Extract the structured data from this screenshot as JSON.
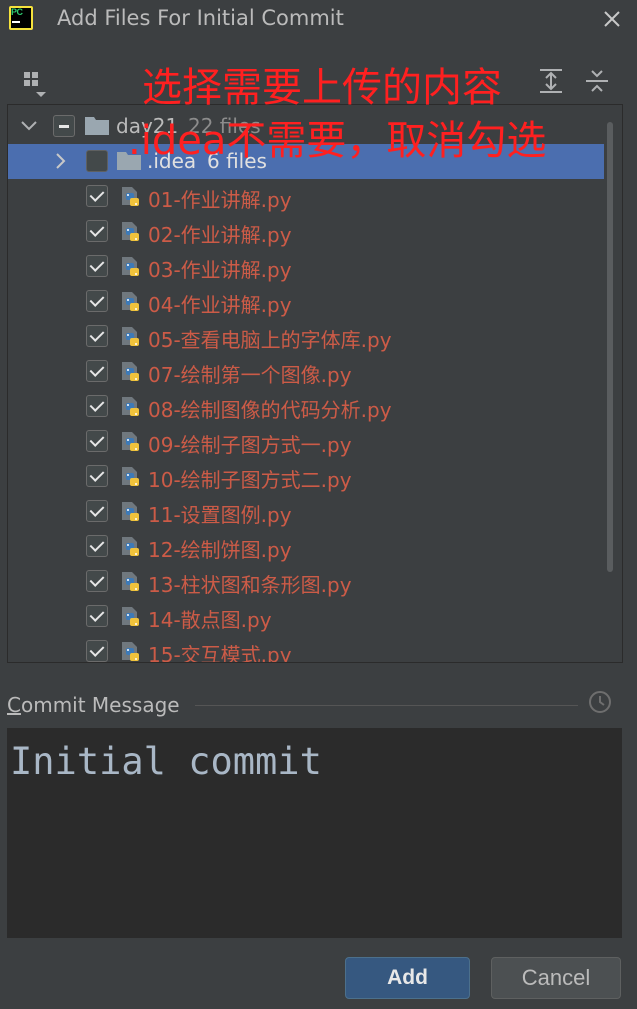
{
  "window": {
    "title": "Add Files For Initial Commit"
  },
  "tree": {
    "root": {
      "name": "day21",
      "count": "22 files"
    },
    "idea": {
      "name": ".idea",
      "count": "6 files"
    },
    "files": [
      "01-作业讲解.py",
      "02-作业讲解.py",
      "03-作业讲解.py",
      "04-作业讲解.py",
      "05-查看电脑上的字体库.py",
      "07-绘制第一个图像.py",
      "08-绘制图像的代码分析.py",
      "09-绘制子图方式一.py",
      "10-绘制子图方式二.py",
      "11-设置图例.py",
      "12-绘制饼图.py",
      "13-柱状图和条形图.py",
      "14-散点图.py",
      "15-交互模式.py"
    ]
  },
  "commit": {
    "label_prefix": "C",
    "label_rest": "ommit Message",
    "message": "Initial commit"
  },
  "buttons": {
    "add": "Add",
    "cancel": "Cancel"
  },
  "annotations": {
    "line1": "选择需要上传的内容",
    "line2": ".idea不需要，取消勾选"
  },
  "colors": {
    "file_text": "#cc5b47",
    "selection": "#4b6eaf",
    "annotation": "#ff2020"
  }
}
